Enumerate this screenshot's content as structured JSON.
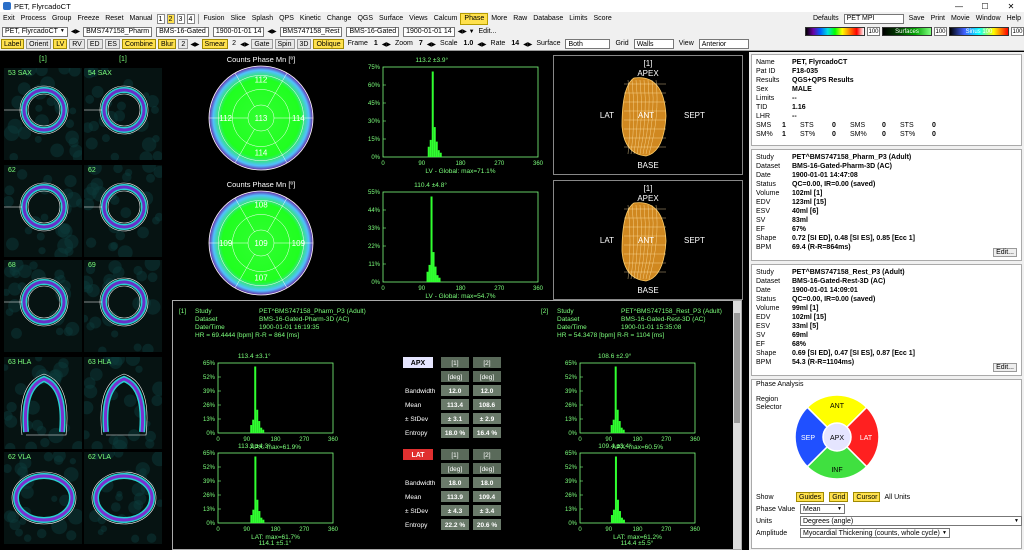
{
  "window": {
    "title": "PET, FlyrcadoCT",
    "min": "—",
    "max": "☐",
    "close": "✕"
  },
  "menu": {
    "left": [
      "Exit",
      "Process",
      "Group",
      "Freeze",
      "Reset",
      "Manual"
    ],
    "nums": [
      "1",
      "2",
      "3",
      "4"
    ],
    "right": [
      "Fusion",
      "Slice",
      "Splash",
      "QPS",
      "Kinetic",
      "Change",
      "QGS",
      "Surface",
      "Views",
      "Calcum",
      "Phase",
      "More",
      "Raw",
      "Database",
      "Limits",
      "Score"
    ],
    "selected": "Phase",
    "defaults_label": "Defaults",
    "defaults_value": "PET MPI",
    "far": [
      "Save",
      "Print",
      "Movie",
      "Window",
      "Help"
    ]
  },
  "toolbar2": {
    "combo1": "PET, FlyrcadoCT",
    "combo2": "BMS747158_Pharm",
    "combo3": "BMS-16-Gated",
    "combo4": "1900-01-01 14",
    "combo5": "BMS747158_Rest",
    "combo6": "BMS-16-Gated",
    "combo7": "1900-01-01 14",
    "edit": "Edit...",
    "c1num": "100",
    "c2num": "100",
    "c2lbl": "Surfaces",
    "c3num": "100",
    "c3lbl": "Sinus 100"
  },
  "toolbar3": {
    "items": [
      "Label",
      "Orient",
      "LV",
      "RV",
      "ED",
      "ES",
      "Combine",
      "Blur",
      "2"
    ],
    "smear": "Smear",
    "smear_val": "2",
    "gate": "Gate",
    "spin": "Spin",
    "d3": "3D",
    "oblique": "Oblique",
    "frame_lbl": "Frame",
    "frame_val": "1",
    "zoom_lbl": "Zoom",
    "zoom_val": "7",
    "scale_lbl": "Scale",
    "scale_val": "1.0",
    "rate_lbl": "Rate",
    "rate_val": "14",
    "surface_lbl": "Surface",
    "surface_val": "Both",
    "grid_lbl": "Grid",
    "grid_val": "Walls",
    "view_lbl": "View",
    "view_val": "Anterior"
  },
  "slices": {
    "headers": [
      "[1]",
      "[1]"
    ],
    "labels": [
      "53 SAX",
      "54 SAX",
      "62",
      "62",
      "68",
      "69",
      "63 HLA",
      "63 HLA",
      "62 VLA",
      "62 VLA"
    ]
  },
  "polar": [
    {
      "title": "Counts Phase Mn [º]",
      "center": "113",
      "top": "112",
      "left": "112",
      "right": "114",
      "bottom": "114"
    },
    {
      "title": "Counts Phase Mn [º]",
      "center": "109",
      "top": "108",
      "left": "109",
      "right": "109",
      "bottom": "107"
    }
  ],
  "hist_top": [
    {
      "peak": "113.2 ±3.9°",
      "ylabels": [
        "75%",
        "60%",
        "45%",
        "30%",
        "15%",
        "0%"
      ],
      "xlabels": [
        "0",
        "90",
        "180",
        "270",
        "360"
      ],
      "caption": "LV - Global:  max=71.1%"
    },
    {
      "peak": "110.4 ±4.8°",
      "ylabels": [
        "55%",
        "44%",
        "33%",
        "22%",
        "11%",
        "0%"
      ],
      "xlabels": [
        "0",
        "90",
        "180",
        "270",
        "360"
      ],
      "caption": "LV - Global:  max=54.7%"
    }
  ],
  "views3d": [
    {
      "label": "[1]",
      "apex": "APEX",
      "lat": "LAT",
      "ant": "ANT",
      "sept": "SEPT",
      "base": "BASE"
    },
    {
      "label": "[1]",
      "apex": "APEX",
      "lat": "LAT",
      "ant": "ANT",
      "sept": "SEPT",
      "base": "BASE"
    }
  ],
  "analysis": {
    "left": {
      "idx": "[1]",
      "study_k": "Study",
      "study_v": "PET^BMS747158_Pharm_P3 (Adult)",
      "ds_k": "Dataset",
      "ds_v": "BMS-16-Gated-Pharm-3D (AC)",
      "dt_k": "Date/Time",
      "dt_v": "1900-01-01 16:19:35",
      "hr": "HR = 69.4444 [bpm]  R-R = 864 [ms]"
    },
    "right": {
      "idx": "[2]",
      "study_k": "Study",
      "study_v": "PET^BMS747158_Rest_P3 (Adult)",
      "ds_k": "Dataset",
      "ds_v": "BMS-16-Gated-Rest-3D (AC)",
      "dt_k": "Date/Time",
      "dt_v": "1900-01-01 15:35:08",
      "hr": "HR = 54.3478 [bpm]  R-R = 1104 [ms]"
    },
    "hists": [
      {
        "peak": "113.4 ±3.1°",
        "caption": "APX:  max=61.9%"
      },
      {
        "peak": "113.9 ±4.3°",
        "caption": "LAT:  max=61.7%"
      },
      {
        "peak": "108.6 ±2.9°",
        "caption": "APX:  max=60.5%"
      },
      {
        "peak": "109.4 ±3.4°",
        "caption": "LAT:  max=61.2%"
      }
    ],
    "ylabels": [
      "65%",
      "52%",
      "39%",
      "26%",
      "13%",
      "0%"
    ],
    "xlabels": [
      "0",
      "90",
      "180",
      "270",
      "360"
    ],
    "bottom_left": "114.1 ±5.1°",
    "bottom_right": "114.4 ±5.5°",
    "apx": {
      "label": "APX",
      "c1": "[1]",
      "c2": "[2]",
      "unit": "[deg]",
      "bw": "Bandwidth",
      "bw1": "12.0",
      "bw2": "12.0",
      "mean": "Mean",
      "m1": "113.4",
      "m2": "108.6",
      "sd": "± StDev",
      "s1": "± 3.1",
      "s2": "± 2.9",
      "ent": "Entropy",
      "e1": "18.0 %",
      "e2": "16.4 %"
    },
    "lat": {
      "label": "LAT",
      "c1": "[1]",
      "c2": "[2]",
      "unit": "[deg]",
      "bw": "Bandwidth",
      "bw1": "18.0",
      "bw2": "18.0",
      "mean": "Mean",
      "m1": "113.9",
      "m2": "109.4",
      "sd": "± StDev",
      "s1": "± 4.3",
      "s2": "± 3.4",
      "ent": "Entropy",
      "e1": "22.2 %",
      "e2": "20.6 %"
    }
  },
  "info": {
    "patient": [
      [
        "Name",
        "PET, FlyrcadoCT"
      ],
      [
        "Pat ID",
        "F18-035"
      ],
      [
        "Results",
        "QGS+QPS Results"
      ],
      [
        "Sex",
        "MALE"
      ],
      [
        "Limits",
        "--"
      ],
      [
        "TID",
        "1.16"
      ],
      [
        "LHR",
        "--"
      ]
    ],
    "sms": [
      [
        "SMS",
        "1",
        "STS",
        "0",
        "SMS",
        "0",
        "STS",
        "0"
      ],
      [
        "SM%",
        "1",
        "ST%",
        "0",
        "SM%",
        "0",
        "ST%",
        "0"
      ]
    ],
    "study1": [
      [
        "Study",
        "PET^BMS747158_Pharm_P3 (Adult)"
      ],
      [
        "Dataset",
        "BMS-16-Gated-Pharm-3D (AC)"
      ],
      [
        "Date",
        "1900-01-01 14:47:08"
      ],
      [
        "Status",
        "QC=0.00, IR=0.00 (saved)"
      ],
      [
        "Volume",
        "102ml [1]"
      ],
      [
        "EDV",
        "123ml [15]"
      ],
      [
        "ESV",
        "40ml [6]"
      ],
      [
        "SV",
        "83ml"
      ],
      [
        "EF",
        "67%"
      ],
      [
        "Shape",
        "0.72 [SI ED],  0.48 [SI ES],  0.85 [Ecc 1]"
      ],
      [
        "BPM",
        "69.4 (R-R=864ms)"
      ]
    ],
    "study2": [
      [
        "Study",
        "PET^BMS747158_Rest_P3 (Adult)"
      ],
      [
        "Dataset",
        "BMS-16-Gated-Rest-3D (AC)"
      ],
      [
        "Date",
        "1900-01-01 14:09:01"
      ],
      [
        "Status",
        "QC=0.00, IR=0.00 (saved)"
      ],
      [
        "Volume",
        "99ml [1]"
      ],
      [
        "EDV",
        "102ml [15]"
      ],
      [
        "ESV",
        "33ml [5]"
      ],
      [
        "SV",
        "69ml"
      ],
      [
        "EF",
        "68%"
      ],
      [
        "Shape",
        "0.69 [SI ED],  0.47 [SI ES],  0.87 [Ecc 1]"
      ],
      [
        "BPM",
        "54.3 (R-R=1104ms)"
      ]
    ],
    "edit": "Edit...",
    "phase_title": "Phase Analysis",
    "region_label": "Region\nSelector",
    "wheel": {
      "ant": "ANT",
      "sep": "SEP",
      "lat": "LAT",
      "inf": "INF",
      "apx": "APX"
    },
    "show_lbl": "Show",
    "show_btns": [
      "Guides",
      "Grid",
      "Cursor"
    ],
    "all_units": "All Units",
    "pv_lbl": "Phase Value",
    "pv_val": "Mean",
    "units_lbl": "Units",
    "units_val": "Degrees (angle)",
    "amp_lbl": "Amplitude",
    "amp_val": "Myocardial Thickening (counts, whole cycle)"
  }
}
